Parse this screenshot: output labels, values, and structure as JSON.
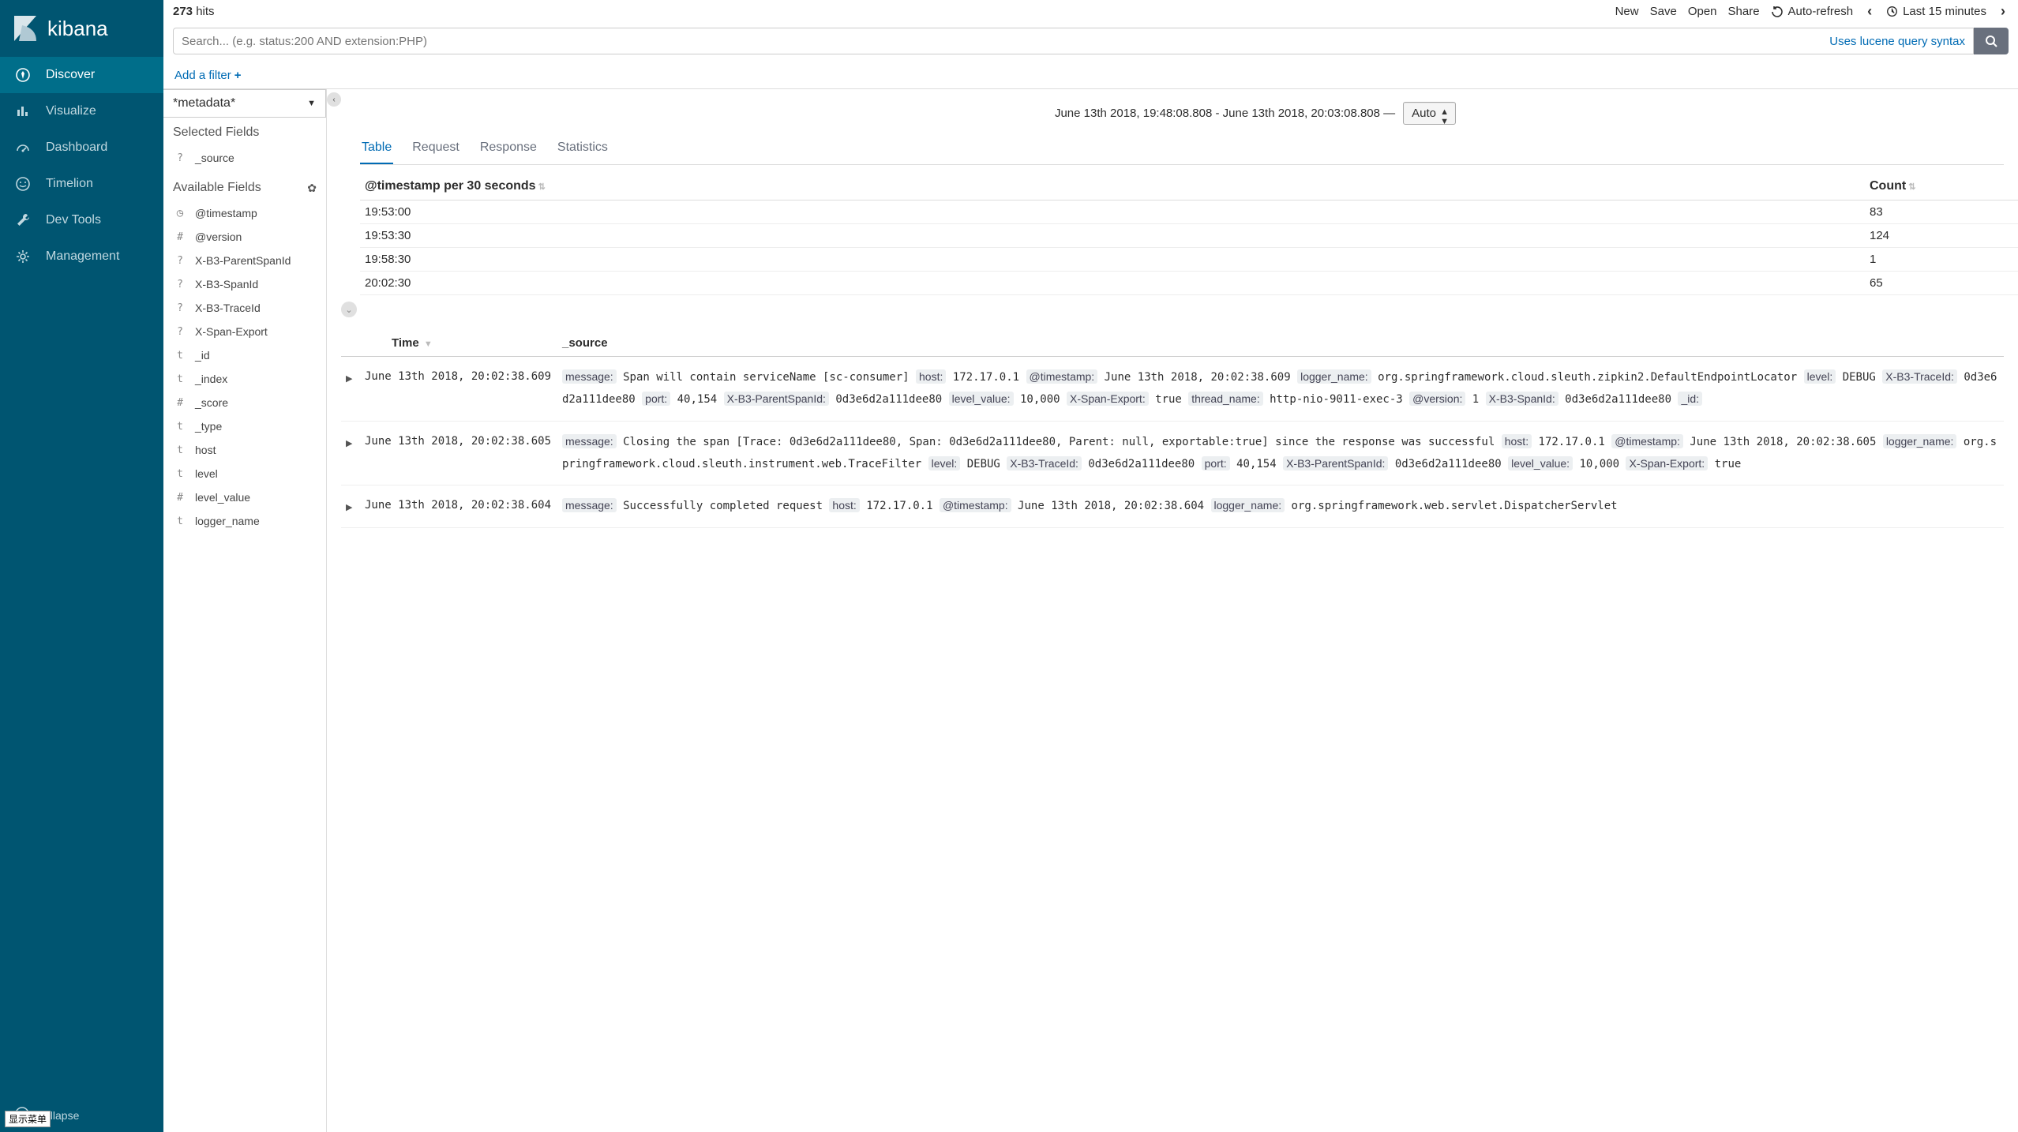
{
  "brand": "kibana",
  "sidebar": {
    "items": [
      {
        "label": "Discover",
        "icon": "compass",
        "active": true
      },
      {
        "label": "Visualize",
        "icon": "bar-chart",
        "active": false
      },
      {
        "label": "Dashboard",
        "icon": "gauge",
        "active": false
      },
      {
        "label": "Timelion",
        "icon": "face",
        "active": false
      },
      {
        "label": "Dev Tools",
        "icon": "wrench",
        "active": false
      },
      {
        "label": "Management",
        "icon": "gear",
        "active": false
      }
    ],
    "collapse_label": "ollapse"
  },
  "topbar": {
    "hits_count": "273",
    "hits_label": "hits",
    "actions": {
      "new": "New",
      "save": "Save",
      "open": "Open",
      "share": "Share",
      "auto_refresh": "Auto-refresh"
    },
    "time_label": "Last 15 minutes"
  },
  "search": {
    "placeholder": "Search... (e.g. status:200 AND extension:PHP)",
    "lucene_hint": "Uses lucene query syntax"
  },
  "filter_bar": {
    "add_filter": "Add a filter"
  },
  "fields_panel": {
    "index_pattern": "*metadata*",
    "selected_header": "Selected Fields",
    "selected": [
      {
        "type": "?",
        "name": "_source"
      }
    ],
    "available_header": "Available Fields",
    "available": [
      {
        "type": "clock",
        "name": "@timestamp"
      },
      {
        "type": "#",
        "name": "@version"
      },
      {
        "type": "?",
        "name": "X-B3-ParentSpanId"
      },
      {
        "type": "?",
        "name": "X-B3-SpanId"
      },
      {
        "type": "?",
        "name": "X-B3-TraceId"
      },
      {
        "type": "?",
        "name": "X-Span-Export"
      },
      {
        "type": "t",
        "name": "_id"
      },
      {
        "type": "t",
        "name": "_index"
      },
      {
        "type": "#",
        "name": "_score"
      },
      {
        "type": "t",
        "name": "_type"
      },
      {
        "type": "t",
        "name": "host"
      },
      {
        "type": "t",
        "name": "level"
      },
      {
        "type": "#",
        "name": "level_value"
      },
      {
        "type": "t",
        "name": "logger_name"
      }
    ]
  },
  "results": {
    "time_range": "June 13th 2018, 19:48:08.808 - June 13th 2018, 20:03:08.808 —",
    "interval": "Auto",
    "tabs": [
      "Table",
      "Request",
      "Response",
      "Statistics"
    ],
    "active_tab": 0,
    "histogram": {
      "col1": "@timestamp per 30 seconds",
      "col2": "Count",
      "rows": [
        {
          "ts": "19:53:00",
          "count": "83"
        },
        {
          "ts": "19:53:30",
          "count": "124"
        },
        {
          "ts": "19:58:30",
          "count": "1"
        },
        {
          "ts": "20:02:30",
          "count": "65"
        }
      ]
    },
    "docs_header": {
      "time": "Time",
      "source": "_source"
    },
    "docs": [
      {
        "time": "June 13th 2018, 20:02:38.609",
        "kv": [
          {
            "k": "message:",
            "v": "Span will contain serviceName [sc-consumer]"
          },
          {
            "k": "host:",
            "v": "172.17.0.1"
          },
          {
            "k": "@timestamp:",
            "v": "June 13th 2018, 20:02:38.609"
          },
          {
            "k": "logger_name:",
            "v": "org.springframework.cloud.sleuth.zipkin2.DefaultEndpointLocator"
          },
          {
            "k": "level:",
            "v": "DEBUG"
          },
          {
            "k": "X-B3-TraceId:",
            "v": "0d3e6d2a111dee80"
          },
          {
            "k": "port:",
            "v": "40,154"
          },
          {
            "k": "X-B3-ParentSpanId:",
            "v": "0d3e6d2a111dee80"
          },
          {
            "k": "level_value:",
            "v": "10,000"
          },
          {
            "k": "X-Span-Export:",
            "v": "true"
          },
          {
            "k": "thread_name:",
            "v": "http-nio-9011-exec-3"
          },
          {
            "k": "@version:",
            "v": "1"
          },
          {
            "k": "X-B3-SpanId:",
            "v": "0d3e6d2a111dee80"
          },
          {
            "k": "_id:",
            "v": ""
          }
        ]
      },
      {
        "time": "June 13th 2018, 20:02:38.605",
        "kv": [
          {
            "k": "message:",
            "v": "Closing the span [Trace: 0d3e6d2a111dee80, Span: 0d3e6d2a111dee80, Parent: null, exportable:true] since the response was successful"
          },
          {
            "k": "host:",
            "v": "172.17.0.1"
          },
          {
            "k": "@timestamp:",
            "v": "June 13th 2018, 20:02:38.605"
          },
          {
            "k": "logger_name:",
            "v": "org.springframework.cloud.sleuth.instrument.web.TraceFilter"
          },
          {
            "k": "level:",
            "v": "DEBUG"
          },
          {
            "k": "X-B3-TraceId:",
            "v": "0d3e6d2a111dee80"
          },
          {
            "k": "port:",
            "v": "40,154"
          },
          {
            "k": "X-B3-ParentSpanId:",
            "v": "0d3e6d2a111dee80"
          },
          {
            "k": "level_value:",
            "v": "10,000"
          },
          {
            "k": "X-Span-Export:",
            "v": "true"
          }
        ]
      },
      {
        "time": "June 13th 2018, 20:02:38.604",
        "kv": [
          {
            "k": "message:",
            "v": "Successfully completed request"
          },
          {
            "k": "host:",
            "v": "172.17.0.1"
          },
          {
            "k": "@timestamp:",
            "v": "June 13th 2018, 20:02:38.604"
          },
          {
            "k": "logger_name:",
            "v": "org.springframework.web.servlet.DispatcherServlet"
          }
        ]
      }
    ]
  },
  "showmenu_label": "显示菜单"
}
